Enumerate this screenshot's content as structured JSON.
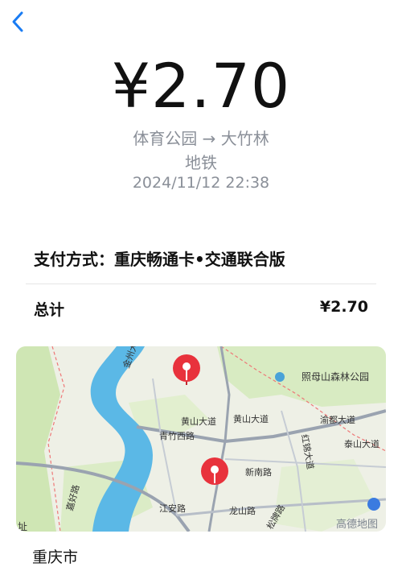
{
  "nav": {
    "back_icon": "chevron-left-icon"
  },
  "trip": {
    "amount": "¥2.70",
    "route": "体育公园 → 大竹林",
    "mode": "地铁",
    "datetime": "2024/11/12 22:38"
  },
  "payment": {
    "label": "支付方式：重庆畅通卡•交通联合版"
  },
  "total": {
    "label": "总计",
    "value": "¥2.70"
  },
  "map": {
    "labels": {
      "jinzhou": "金州大道",
      "zhaomushan": "照母山森林公园",
      "huangshan1": "黄山大道",
      "huangshan2": "黄山大道",
      "yubei": "渝都大道",
      "qingzhu": "青竹西路",
      "taishan": "泰山大道",
      "xinnan": "新南路",
      "hongjin": "红锦大道",
      "jiahao": "嘉好路",
      "jiangan": "江安路",
      "longshan": "龙山路",
      "songpai": "松牌路",
      "watermark": "高德地图",
      "logo_text": "址"
    },
    "colors": {
      "water": "#5bb8e6",
      "pin": "#e8323c",
      "land": "#eef0e6",
      "green": "#d8ebc2"
    }
  },
  "location": {
    "city": "重庆市"
  },
  "colors": {
    "accent": "#1a7cf3",
    "muted": "#8a8f98"
  }
}
